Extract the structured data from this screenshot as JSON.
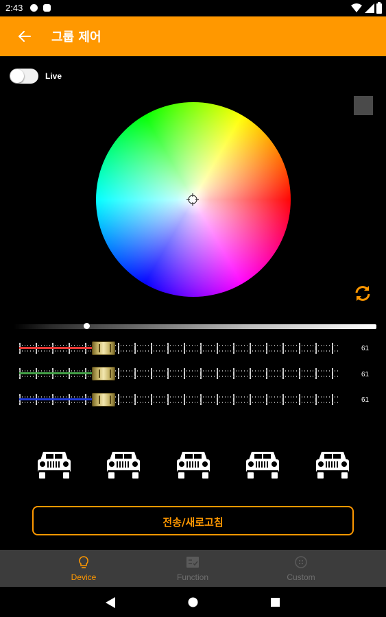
{
  "status_bar": {
    "time": "2:43"
  },
  "app_bar": {
    "title": "그룹 제어",
    "back_icon": "arrow-left-icon"
  },
  "live": {
    "label": "Live",
    "enabled": false
  },
  "preview_color": "#4a4a4a",
  "rgb": [
    {
      "channel": "red",
      "color": "#e53935",
      "value": "61"
    },
    {
      "channel": "green",
      "color": "#43a047",
      "value": "61"
    },
    {
      "channel": "blue",
      "color": "#1e3ad8",
      "value": "61"
    }
  ],
  "brightness_level": 0.2,
  "vehicle_count": 5,
  "send_button": {
    "label": "전송/새로고침"
  },
  "bottom_nav": [
    {
      "label": "Device",
      "icon": "lightbulb-icon",
      "active": true
    },
    {
      "label": "Function",
      "icon": "checklist-icon",
      "active": false
    },
    {
      "label": "Custom",
      "icon": "custom-icon",
      "active": false
    }
  ],
  "colors": {
    "accent": "#FF9800",
    "inactive": "#6e6e6e"
  }
}
